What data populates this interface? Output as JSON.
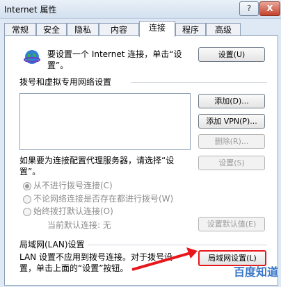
{
  "window": {
    "title": "Internet 属性",
    "help_glyph": "?",
    "close_glyph": "X"
  },
  "tabs": [
    "常规",
    "安全",
    "隐私",
    "内容",
    "连接",
    "程序",
    "高级"
  ],
  "active_tab": "连接",
  "setup": {
    "text_line1": "要设置一个 Internet 连接，单击“设",
    "text_line2": "置”。",
    "button": "设置(U)"
  },
  "dialup": {
    "heading": "拨号和虚拟专用网络设置",
    "add_button": "添加(D)...",
    "add_vpn_button": "添加 VPN(P)...",
    "delete_button": "删除(R)...",
    "settings_button": "设置(S)",
    "proxy_text_line1": "如果要为连接配置代理服务器，请选择“设",
    "proxy_text_line2": "置”。",
    "options": [
      "从不进行拨号连接(C)",
      "不论网络连接是否存在都进行拨号(W)",
      "始终拨打默认连接(O)"
    ],
    "selected_option": 0,
    "current_default_label": "当前默认连接:",
    "current_default_value": "无",
    "set_default_button": "设置默认值(E)"
  },
  "lan": {
    "heading": "局域网(LAN)设置",
    "text_line1": "LAN 设置不应用到拨号连接。对于拨号设",
    "text_line2": "置，单击上面的“设置”按钮。",
    "button": "局域网设置(L)"
  },
  "watermark": "百度知道",
  "colors": {
    "accent_arrow": "#e8161b",
    "title_bg": "#dfe9f5",
    "disabled_text": "#9b9b9b"
  }
}
